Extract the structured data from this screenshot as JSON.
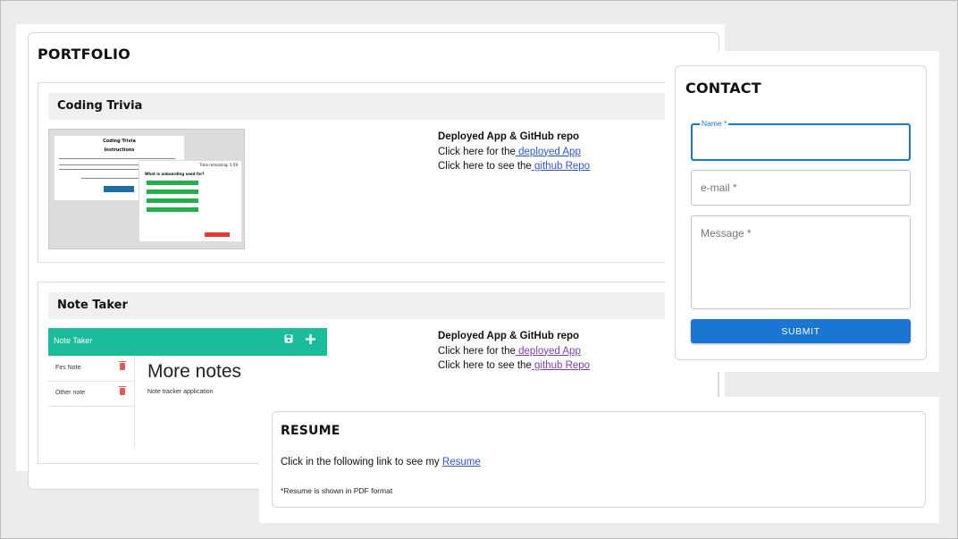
{
  "portfolio": {
    "title": "PORTFOLIO",
    "projects": [
      {
        "title": "Coding Trivia",
        "links_heading": "Deployed App & GitHub repo",
        "app_prefix": "Click here for the",
        "app_link": " deployed App",
        "repo_prefix": "Click here to see the",
        "repo_link": " github Repo",
        "screenshot": {
          "card_title": "Coding Trivia",
          "card_subtitle": "Instructions",
          "panel_timer": "Time remaining: 5:59",
          "panel_question": "What is onboarding used for?"
        }
      },
      {
        "title": "Note Taker",
        "links_heading": "Deployed App & GitHub repo",
        "app_prefix": "Click here for the",
        "app_link": " deployed App",
        "repo_prefix": "Click here to see the",
        "repo_link": " github Repo",
        "screenshot": {
          "app_title": "Note Taker",
          "notes": [
            "Firs Note",
            "Other note"
          ],
          "note_title": "More notes",
          "note_body": "Note tracker application"
        }
      }
    ]
  },
  "contact": {
    "title": "CONTACT",
    "name_label": "Name *",
    "email_placeholder": "e-mail *",
    "message_placeholder": "Message *",
    "submit_label": "SUBMIT",
    "accent": "#1976d2"
  },
  "resume": {
    "title": "RESUME",
    "text_prefix": "Click in the following link to see my ",
    "link": "Resume",
    "note": "*Resume is shown in PDF format"
  },
  "colors": {
    "note_taker_bar": "#1abc9c",
    "link": "#2a56d6",
    "visited_link": "#7b3fb0"
  }
}
